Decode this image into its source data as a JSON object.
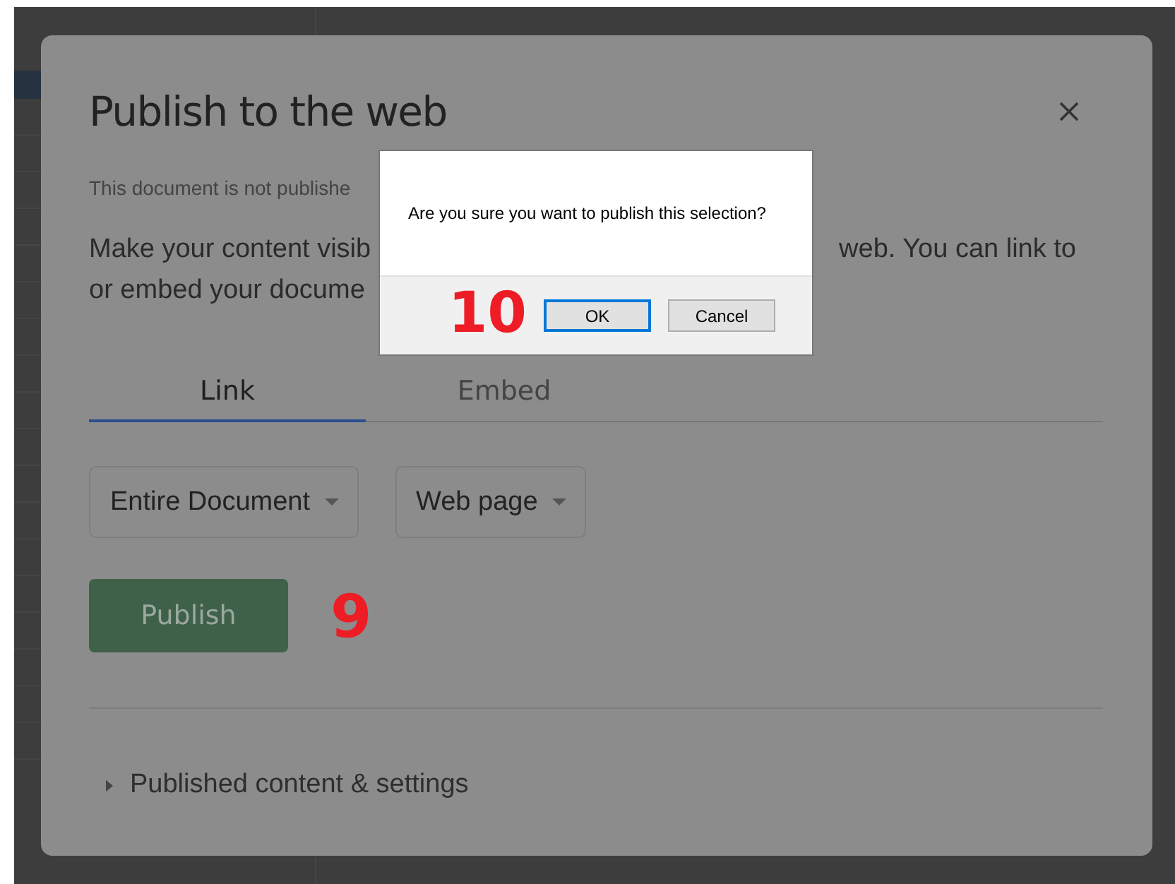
{
  "dialog": {
    "title": "Publish to the web",
    "status_fragment": "This document is not publishe",
    "description_fragments": {
      "line_1_left": "Make your content visib",
      "line_1_right": "web. You can link to",
      "line_2_left": "or embed your docume"
    },
    "tabs": [
      {
        "label": "Link",
        "selected": true
      },
      {
        "label": "Embed",
        "selected": false
      }
    ],
    "dropdowns": [
      {
        "value": "Entire Document"
      },
      {
        "value": "Web page"
      }
    ],
    "publish_button": {
      "label": "Publish",
      "disabled": true
    },
    "section": {
      "label": "Published content & settings",
      "expanded": false
    }
  },
  "confirm": {
    "message": "Are you sure you want to publish this selection?",
    "buttons": [
      {
        "label": "OK",
        "selected": true
      },
      {
        "label": "Cancel",
        "selected": false
      }
    ]
  },
  "annotations": [
    {
      "label": "10"
    },
    {
      "label": "9"
    }
  ]
}
